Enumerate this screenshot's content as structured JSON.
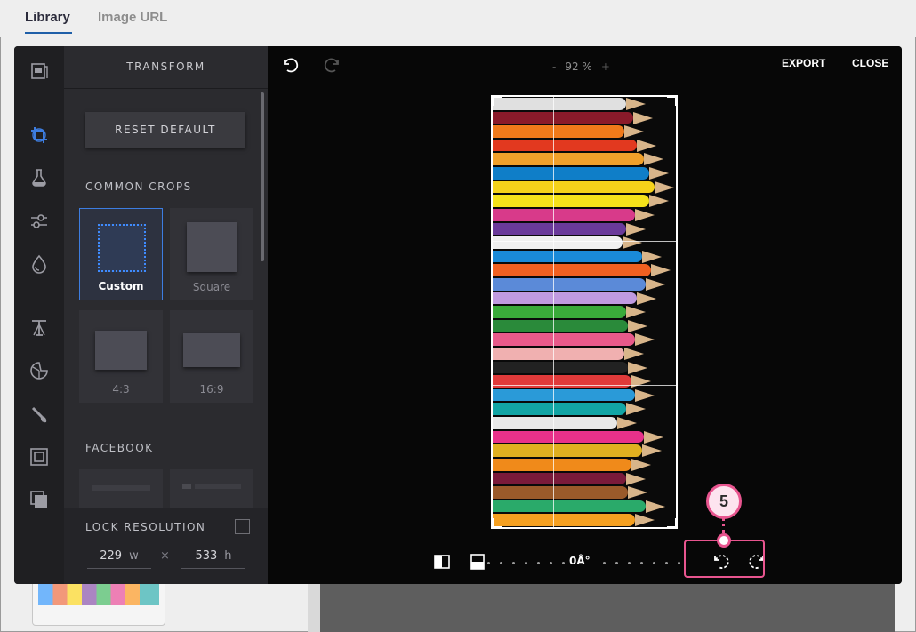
{
  "tabs": [
    {
      "label": "Library",
      "active": true
    },
    {
      "label": "Image URL",
      "active": false
    }
  ],
  "sidebar": {
    "title": "TRANSFORM",
    "reset_label": "RESET DEFAULT",
    "common_crops_label": "COMMON CROPS",
    "crops": [
      {
        "label": "Custom",
        "selected": true
      },
      {
        "label": "Square",
        "selected": false
      },
      {
        "label": "4:3",
        "selected": false
      },
      {
        "label": "16:9",
        "selected": false
      }
    ],
    "facebook_label": "FACEBOOK",
    "lock_label": "LOCK RESOLUTION",
    "width_value": "229",
    "width_unit": "w",
    "times": "×",
    "height_value": "533",
    "height_unit": "h"
  },
  "rail_icons": [
    "image-icon",
    "crop-icon",
    "filter-icon",
    "adjust-icon",
    "color-drop-icon",
    "text-icon",
    "sticker-icon",
    "brush-icon",
    "frame-icon",
    "overlay-icon"
  ],
  "canvas": {
    "zoom_minus": "-",
    "zoom": "92 %",
    "zoom_plus": "+",
    "export_label": "EXPORT",
    "close_label": "CLOSE",
    "rotation_value": "0Â°"
  },
  "callout": {
    "number": "5"
  },
  "colors": {
    "accent": "#3d7de0",
    "callout": "#e8558f",
    "editor_bg": "#0a0a0a",
    "panel_bg": "#2b2b2f"
  },
  "pencils": [
    "#e0e0e0",
    "#8a1a2a",
    "#f07a1a",
    "#e2391f",
    "#f0a02a",
    "#0f7ec8",
    "#f5d21a",
    "#f5e21a",
    "#d83a8a",
    "#6a3a9a",
    "#f0f0f0",
    "#1a8ad8",
    "#f06020",
    "#5b8ad8",
    "#c09ae0",
    "#3aaa3a",
    "#2a8a3a",
    "#e85a8a",
    "#f0b0b0",
    "#222222",
    "#e03a3a",
    "#2a9ad8",
    "#12a5a5",
    "#e8e8e8",
    "#e8318a",
    "#e0b020",
    "#f08a1a",
    "#7a1a3a",
    "#9a5a2a",
    "#2aaa6a",
    "#f5a020"
  ]
}
